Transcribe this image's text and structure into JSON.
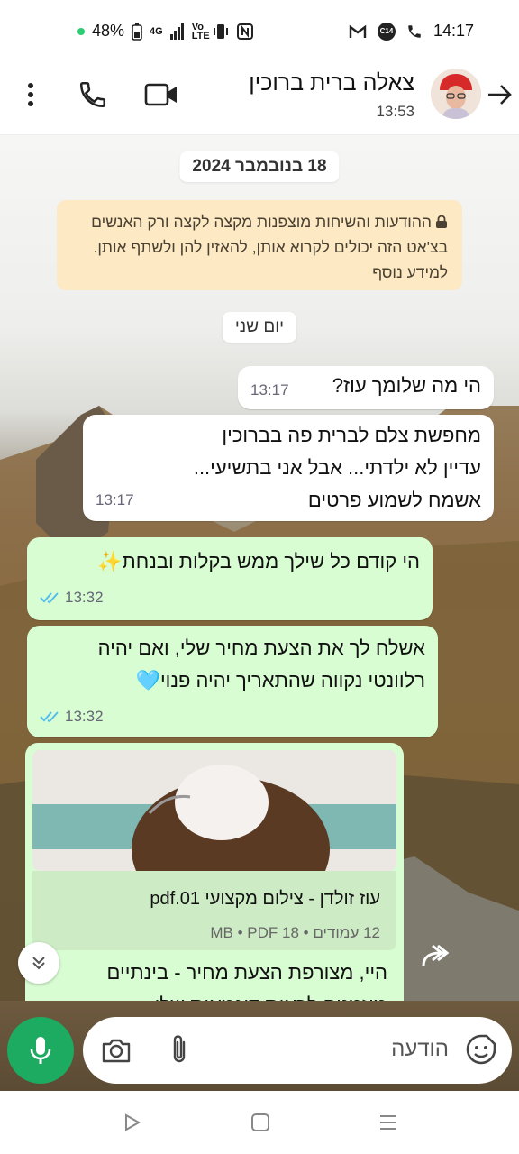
{
  "status_bar": {
    "battery": "48%",
    "network": "4G",
    "volte": "Vo LTE",
    "badge": "C14",
    "time": "14:17"
  },
  "header": {
    "contact_name": "צאלה ברית ברוכין",
    "last_seen": "13:53"
  },
  "chat": {
    "date_chip": "18 בנובמבר 2024",
    "encryption_notice": "ההודעות והשיחות מוצפנות מקצה לקצה ורק האנשים בצ'אט הזה יכולים לקרוא אותן, להאזין להן ולשתף אותן. למידע נוסף",
    "day_chip": "יום שני",
    "messages": [
      {
        "text": "הי מה שלומך עוז?",
        "time": "13:17"
      },
      {
        "line1": "מחפשת צלם לברית פה בברוכין",
        "line2": "עדיין לא ילדתי... אבל אני בתשיעי...",
        "line3": "אשמח לשמוע פרטים",
        "time": "13:17"
      },
      {
        "text": "הי קודם כל שילך ממש בקלות ובנחת✨",
        "time": "13:32"
      },
      {
        "line1": "אשלח לך את הצעת מחיר שלי, ואם יהיה",
        "line2": "רלוונטי נקווה שהתאריך יהיה פנוי🩵",
        "time": "13:32"
      }
    ],
    "file": {
      "name": "עוז זולדן - צילום מקצועי pdf.01",
      "meta": "12 עמודים • 18 MB • PDF",
      "caption_line1": "היי, מצורפת הצעת מחיר - בינתיים",
      "caption_line2": "מוזמנים לראות דוגמאות שלי"
    }
  },
  "input": {
    "placeholder": "הודעה"
  },
  "colors": {
    "outgoing_bubble": "#d9fdd3",
    "incoming_bubble": "#ffffff",
    "mic_button": "#1daa61",
    "read_ticks": "#53bdeb",
    "encryption_notice_bg": "#fdeac4"
  }
}
